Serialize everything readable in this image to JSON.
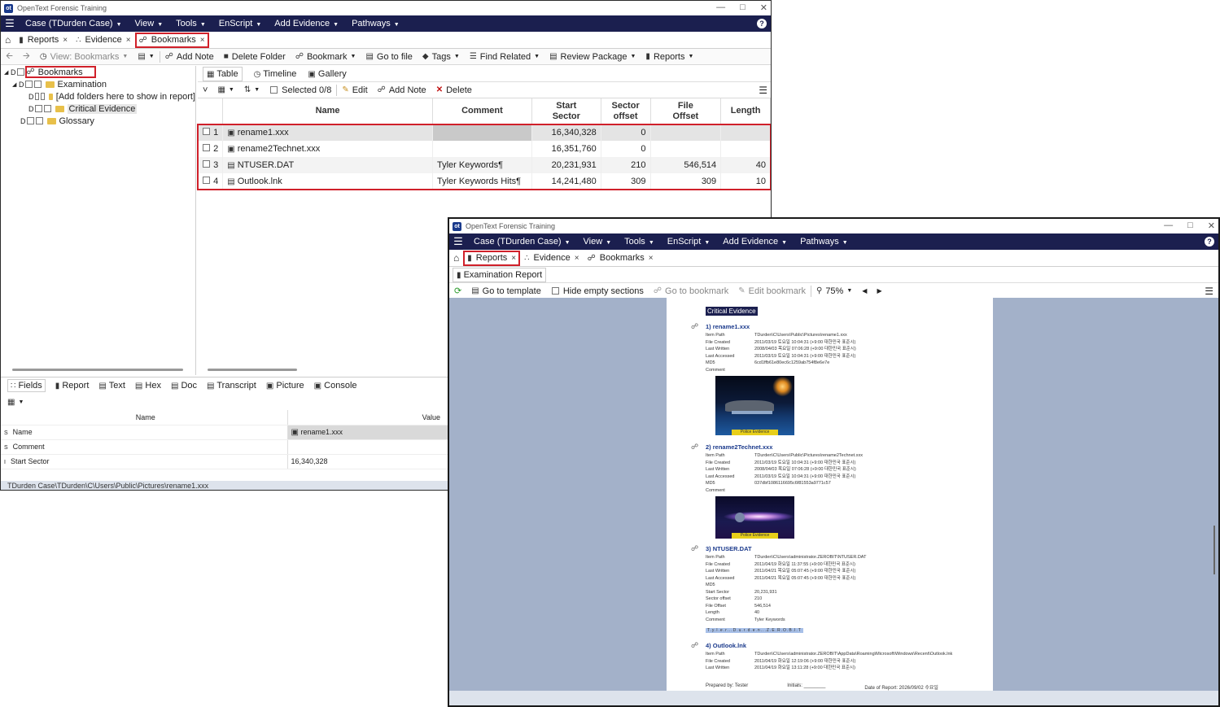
{
  "app": {
    "title": "OpenText Forensic Training",
    "logo": "ot",
    "menus": [
      "Case (TDurden Case)",
      "View",
      "Tools",
      "EnScript",
      "Add Evidence",
      "Pathways"
    ]
  },
  "win1": {
    "tabs": [
      {
        "label": "Reports"
      },
      {
        "label": "Evidence"
      },
      {
        "label": "Bookmarks"
      }
    ],
    "toolbar": {
      "view": "View: Bookmarks",
      "add_note": "Add Note",
      "delete_folder": "Delete Folder",
      "bookmark": "Bookmark",
      "go_to_file": "Go to file",
      "tags": "Tags",
      "find_related": "Find Related",
      "review_package": "Review Package",
      "reports": "Reports"
    },
    "tree": {
      "root": "Bookmarks",
      "examination": "Examination",
      "add_folders": "[Add folders here to show in report]",
      "critical": "Critical Evidence",
      "glossary": "Glossary"
    },
    "subtabs": [
      "Table",
      "Timeline",
      "Gallery"
    ],
    "table_toolbar": {
      "selected": "Selected 0/8",
      "edit": "Edit",
      "add_note": "Add Note",
      "delete": "Delete"
    },
    "columns": {
      "name": "Name",
      "comment": "Comment",
      "start_sector_1": "Start",
      "start_sector_2": "Sector",
      "sector_offset_1": "Sector",
      "sector_offset_2": "offset",
      "file_offset_1": "File",
      "file_offset_2": "Offset",
      "length": "Length"
    },
    "rows": [
      {
        "n": "1",
        "name": "rename1.xxx",
        "comment": "",
        "start": "16,340,328",
        "soff": "0",
        "foff": "",
        "len": ""
      },
      {
        "n": "2",
        "name": "rename2Technet.xxx",
        "comment": "",
        "start": "16,351,760",
        "soff": "0",
        "foff": "",
        "len": ""
      },
      {
        "n": "3",
        "name": "NTUSER.DAT",
        "comment": "Tyler Keywords¶",
        "start": "20,231,931",
        "soff": "210",
        "foff": "546,514",
        "len": "40"
      },
      {
        "n": "4",
        "name": "Outlook.lnk",
        "comment": "Tyler Keywords Hits¶",
        "start": "14,241,480",
        "soff": "309",
        "foff": "309",
        "len": "10"
      }
    ],
    "bottom_tabs": [
      "Fields",
      "Report",
      "Text",
      "Hex",
      "Doc",
      "Transcript",
      "Picture",
      "Console"
    ],
    "fields": {
      "col_name": "Name",
      "col_value": "Value",
      "rows": [
        {
          "k": "Name",
          "v": "rename1.xxx"
        },
        {
          "k": "Comment",
          "v": ""
        },
        {
          "k": "Start Sector",
          "v": "16,340,328"
        }
      ]
    },
    "status": "TDurden Case\\TDurden\\C\\Users\\Public\\Pictures\\rename1.xxx"
  },
  "win2": {
    "tabs": [
      {
        "label": "Reports"
      },
      {
        "label": "Evidence"
      },
      {
        "label": "Bookmarks"
      }
    ],
    "report_tab": "Examination Report",
    "toolbar": {
      "go_to_template": "Go to template",
      "hide_empty": "Hide empty sections",
      "go_to_bookmark": "Go to bookmark",
      "edit_bookmark": "Edit bookmark",
      "zoom": "75%"
    },
    "report": {
      "heading": "Critical Evidence",
      "entries": [
        {
          "title": "1) rename1.xxx",
          "fields": [
            {
              "k": "Item Path",
              "v": "TDurden\\C\\Users\\Public\\Pictures\\rename1.xxx"
            },
            {
              "k": "File Created",
              "v": "2011/03/19 토요일 10:04:31 (+9:00 대한민국 표준시)"
            },
            {
              "k": "Last Written",
              "v": "2008/04/03 목요일 07:06:28 (+9:00 대한민국 표준시)"
            },
            {
              "k": "Last Accessed",
              "v": "2011/03/19 토요일 10:04:31 (+9:00 대한민국 표준시)"
            },
            {
              "k": "MD5",
              "v": "6cd1ffb61e80ec6c1259ab754f8e6e7e"
            },
            {
              "k": "Comment",
              "v": ""
            }
          ],
          "picture_label": "Police Evidence"
        },
        {
          "title": "2) rename2Technet.xxx",
          "fields": [
            {
              "k": "Item Path",
              "v": "TDurden\\C\\Users\\Public\\Pictures\\rename2Technet.xxx"
            },
            {
              "k": "File Created",
              "v": "2011/03/19 토요일 10:04:31 (+9:00 대한민국 표준시)"
            },
            {
              "k": "Last Written",
              "v": "2008/04/03 목요일 07:06:28 (+9:00 대한민국 표준시)"
            },
            {
              "k": "Last Accessed",
              "v": "2011/03/19 토요일 10:04:31 (+9:00 대한민국 표준시)"
            },
            {
              "k": "MD5",
              "v": "037dbf1086116695c6f81553a9771c57"
            },
            {
              "k": "Comment",
              "v": ""
            }
          ],
          "picture_label": "Police Evidence"
        },
        {
          "title": "3) NTUSER.DAT",
          "fields": [
            {
              "k": "Item Path",
              "v": "TDurden\\C\\Users\\administrator.ZEROBIT\\NTUSER.DAT"
            },
            {
              "k": "File Created",
              "v": "2011/04/19 화요일 11:37:55 (+9:00 대한민국 표준시)"
            },
            {
              "k": "Last Written",
              "v": "2011/04/21 목요일 05:07:45 (+9:00 대한민국 표준시)"
            },
            {
              "k": "Last Accessed",
              "v": "2011/04/21 목요일 05:07:45 (+9:00 대한민국 표준시)"
            },
            {
              "k": "MD5",
              "v": ""
            },
            {
              "k": "Start Sector",
              "v": "20,231,931"
            },
            {
              "k": "Sector offset",
              "v": "210"
            },
            {
              "k": "File Offset",
              "v": "546,514"
            },
            {
              "k": "Length",
              "v": "40"
            },
            {
              "k": "Comment",
              "v": "Tyler Keywords"
            }
          ],
          "hit": "T.y.l.e.r...D.u.r.d.e.n...Z.E.R.O.B.I.T"
        },
        {
          "title": "4) Outlook.lnk",
          "fields": [
            {
              "k": "Item Path",
              "v": "TDurden\\C\\Users\\administrator.ZEROBIT\\AppData\\Roaming\\Microsoft\\Windows\\Recent\\Outlook.lnk"
            },
            {
              "k": "File Created",
              "v": "2011/04/19 화요일 12:19:06 (+9:00 대한민국 표준시)"
            },
            {
              "k": "Last Written",
              "v": "2011/04/19 화요일 13:11:28 (+9:00 대한민국 표준시)"
            }
          ]
        }
      ],
      "footer": {
        "prepared": "Prepared by: Tester",
        "initials": "Initials: ________",
        "date": "Date of Report: 2026/09/02 수요일"
      }
    }
  },
  "colors": {
    "menubar": "#1b1f4f",
    "highlight": "#d0202a",
    "report_bg": "#a3b1c9"
  }
}
